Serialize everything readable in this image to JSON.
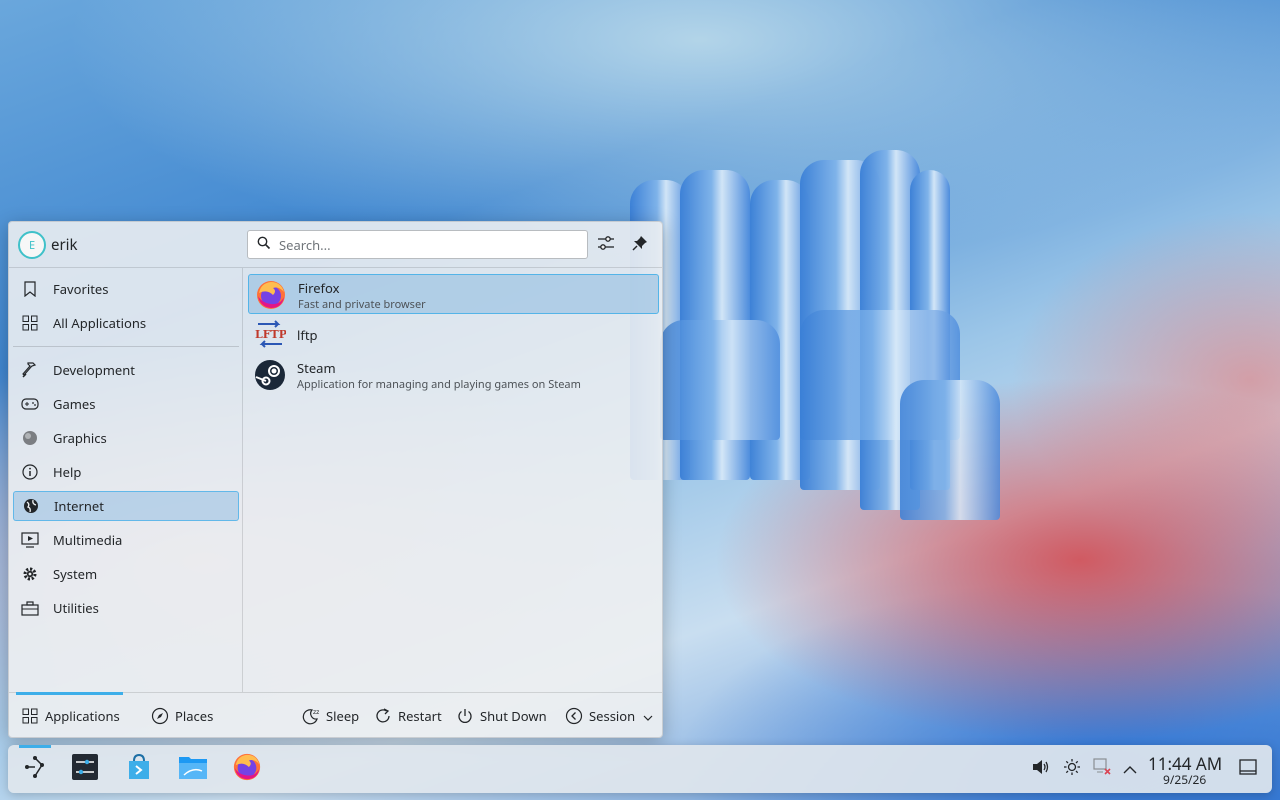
{
  "launcher": {
    "user": {
      "initial": "E",
      "name": "erik"
    },
    "search": {
      "placeholder": "Search..."
    },
    "categories": [
      {
        "label": "Favorites",
        "icon": "bookmark-icon"
      },
      {
        "label": "All Applications",
        "icon": "grid-icon"
      },
      {
        "label": "Development",
        "icon": "hammer-icon"
      },
      {
        "label": "Games",
        "icon": "gamepad-icon"
      },
      {
        "label": "Graphics",
        "icon": "graphics-icon"
      },
      {
        "label": "Help",
        "icon": "info-icon"
      },
      {
        "label": "Internet",
        "icon": "globe-icon",
        "selected": true
      },
      {
        "label": "Multimedia",
        "icon": "multimedia-icon"
      },
      {
        "label": "System",
        "icon": "gear-icon"
      },
      {
        "label": "Utilities",
        "icon": "toolbox-icon"
      }
    ],
    "apps": [
      {
        "name": "Firefox",
        "description": "Fast and private browser",
        "icon": "firefox-icon",
        "selected": true
      },
      {
        "name": "lftp",
        "description": "",
        "icon": "lftp-icon"
      },
      {
        "name": "Steam",
        "description": "Application for managing and playing games on Steam",
        "icon": "steam-icon"
      }
    ],
    "footer": {
      "applications": "Applications",
      "places": "Places",
      "sleep": "Sleep",
      "restart": "Restart",
      "shutdown": "Shut Down",
      "session": "Session"
    }
  },
  "taskbar": {
    "clock": {
      "time": "11:44 AM",
      "date": "9/25/26"
    }
  },
  "colors": {
    "accent": "#3daee9",
    "selection": "#93bee1"
  }
}
